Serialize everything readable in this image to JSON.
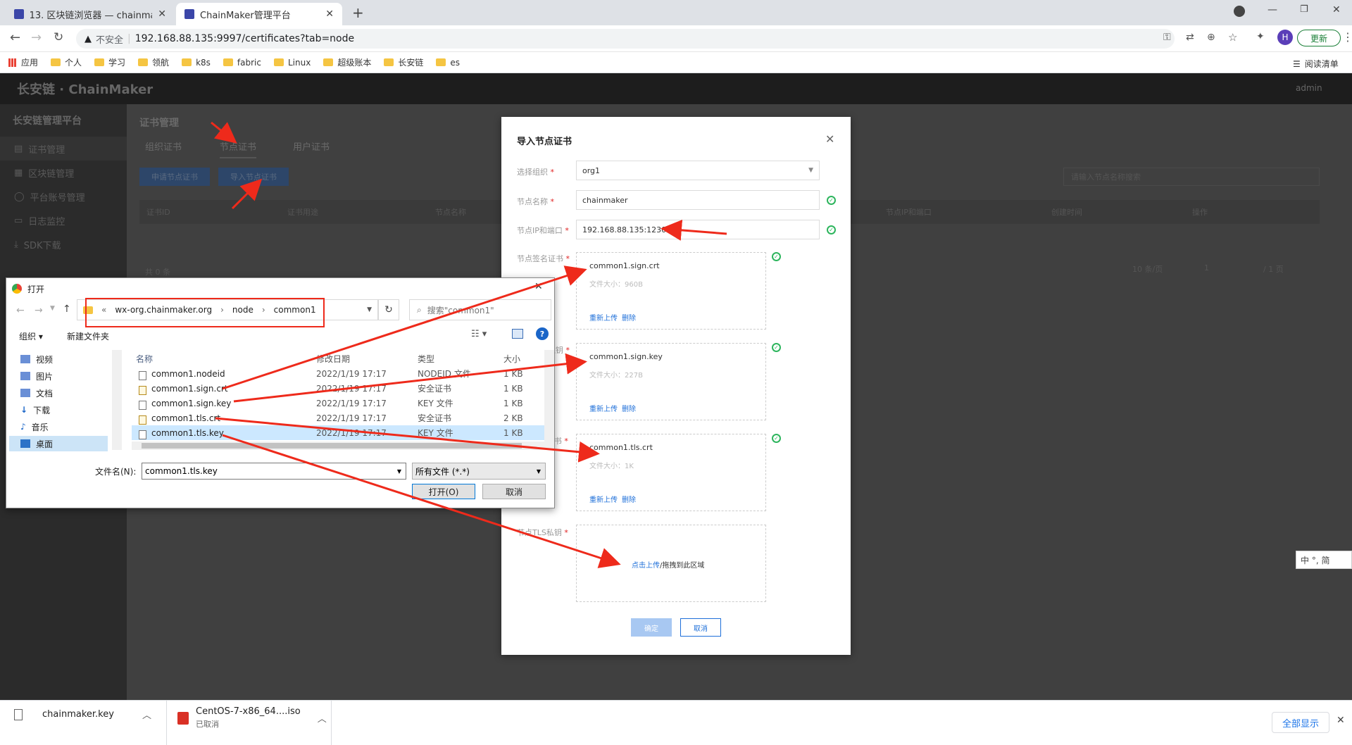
{
  "tabs": [
    {
      "title": "13. 区块链浏览器 — chainmake"
    },
    {
      "title": "ChainMaker管理平台"
    }
  ],
  "address": {
    "security": "不安全",
    "url": "192.168.88.135:9997/certificates?tab=node"
  },
  "profile": {
    "initial": "H",
    "update_label": "更新"
  },
  "bookmarks": {
    "apps": "应用",
    "folders": [
      "个人",
      "学习",
      "领航",
      "k8s",
      "fabric",
      "Linux",
      "超级账本",
      "长安链",
      "es"
    ],
    "reading_list": "阅读清单"
  },
  "app": {
    "logo": "长安链 · ChainMaker",
    "user": "admin",
    "platform": "长安链管理平台",
    "menu": [
      "证书管理",
      "区块链管理",
      "平台账号管理",
      "日志监控",
      "SDK下载"
    ],
    "page_title": "证书管理",
    "tabs": [
      "组织证书",
      "节点证书",
      "用户证书"
    ],
    "buttons": {
      "apply": "申请节点证书",
      "import": "导入节点证书"
    },
    "search_placeholder": "请输入节点名称搜索",
    "columns": [
      "证书ID",
      "证书用途",
      "节点名称",
      "节点IP和端口",
      "创建时间",
      "操作"
    ],
    "total": "共 0 条",
    "page_size": "10 条/页",
    "page_num": "1",
    "page_total": "/ 1 页"
  },
  "modal": {
    "title": "导入节点证书",
    "org_label": "选择组织",
    "org_value": "org1",
    "name_label": "节点名称",
    "name_value": "chainmaker",
    "ip_label": "节点IP和端口",
    "ip_value": "192.168.88.135:12301",
    "sign_cert_label": "节点签名证书",
    "sign_key_label": "节点签名私钥",
    "tls_cert_label": "节点TLS证书",
    "tls_key_label": "节点TLS私钥",
    "uploads": [
      {
        "name": "common1.sign.crt",
        "size": "文件大小：960B"
      },
      {
        "name": "common1.sign.key",
        "size": "文件大小：227B"
      },
      {
        "name": "common1.tls.crt",
        "size": "文件大小：1K"
      }
    ],
    "reupload": "重新上传",
    "delete": "删除",
    "drop_link": "点击上传",
    "drop_text": "/拖拽到此区域",
    "ok": "确定",
    "cancel": "取消"
  },
  "dialog": {
    "title": "打开",
    "path": [
      "wx-org.chainmaker.org",
      "node",
      "common1"
    ],
    "search": "搜索\"common1\"",
    "organize": "组织",
    "new_folder": "新建文件夹",
    "nav": [
      "视频",
      "图片",
      "文档",
      "下载",
      "音乐",
      "桌面"
    ],
    "headers": [
      "名称",
      "修改日期",
      "类型",
      "大小"
    ],
    "files": [
      {
        "name": "common1.nodeid",
        "date": "2022/1/19 17:17",
        "type": "NODEID 文件",
        "size": "1 KB",
        "kind": "file"
      },
      {
        "name": "common1.sign.crt",
        "date": "2022/1/19 17:17",
        "type": "安全证书",
        "size": "1 KB",
        "kind": "cert"
      },
      {
        "name": "common1.sign.key",
        "date": "2022/1/19 17:17",
        "type": "KEY 文件",
        "size": "1 KB",
        "kind": "file"
      },
      {
        "name": "common1.tls.crt",
        "date": "2022/1/19 17:17",
        "type": "安全证书",
        "size": "2 KB",
        "kind": "cert"
      },
      {
        "name": "common1.tls.key",
        "date": "2022/1/19 17:17",
        "type": "KEY 文件",
        "size": "1 KB",
        "kind": "file"
      }
    ],
    "filename_label": "文件名(N):",
    "filename_value": "common1.tls.key",
    "filter": "所有文件 (*.*)",
    "open": "打开(O)",
    "cancel": "取消"
  },
  "ime": "中 °, 简",
  "downloads": [
    {
      "name": "chainmaker.key",
      "status": ""
    },
    {
      "name": "CentOS-7-x86_64....iso",
      "status": "已取消"
    }
  ],
  "show_all": "全部显示",
  "colors": {
    "accent": "#1e6fd9",
    "annotation": "#ee2a1b",
    "success": "#2db55d",
    "chrome": "#dee1e6"
  }
}
